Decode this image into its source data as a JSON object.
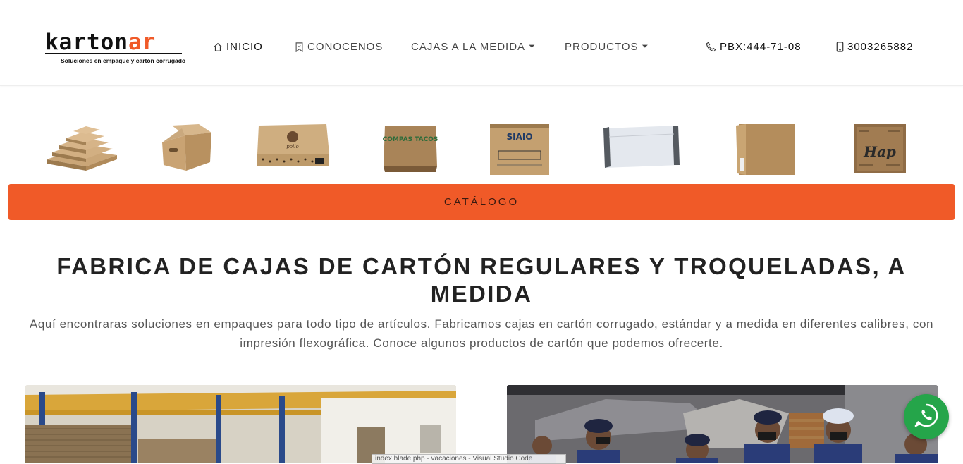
{
  "brand": {
    "logo_prefix": "karton",
    "logo_highlight": "ar",
    "tagline": "Soluciones en empaque y cartón corrugado"
  },
  "nav": {
    "home": {
      "label": "INICIO",
      "icon": "home-icon"
    },
    "about": {
      "label": "CONOCENOS",
      "icon": "bookmark-icon"
    },
    "custom_boxes": {
      "label": "CAJAS A LA MEDIDA",
      "caret": "⏷"
    },
    "products": {
      "label": "PRODUCTOS",
      "caret": "⏷"
    },
    "pbx": {
      "label": "PBX:444-71-08",
      "icon": "phone-icon"
    },
    "mobile": {
      "label": "3003265882",
      "icon": "mobile-phone-icon"
    }
  },
  "product_thumbs": [
    {
      "name": "stacked-trays"
    },
    {
      "name": "archive-box"
    },
    {
      "name": "printed-flat-box",
      "label": "pollo"
    },
    {
      "name": "pizza-box",
      "label": "COMPAS TACOS"
    },
    {
      "name": "siaio-box",
      "label": "SIAIO"
    },
    {
      "name": "white-mailer-box"
    },
    {
      "name": "kraft-tall-box"
    },
    {
      "name": "hap-box",
      "label": "Hap"
    }
  ],
  "catalog_button": "CATÁLOGO",
  "headline": "FABRICA DE CAJAS DE CARTÓN REGULARES Y TROQUELADAS, A MEDIDA",
  "intro": "Aquí encontraras soluciones en empaques para todo tipo de artículos. Fabricamos cajas en cartón corrugado, estándar y a medida en diferentes calibres, con impresión flexográfica. Conoce algunos productos de cartón que podemos ofrecerte.",
  "os_tooltip": "index.blade.php - vacaciones - Visual Studio Code",
  "colors": {
    "accent": "#f05a28",
    "whatsapp": "#25a54a",
    "kraft": "#b08a5a"
  }
}
